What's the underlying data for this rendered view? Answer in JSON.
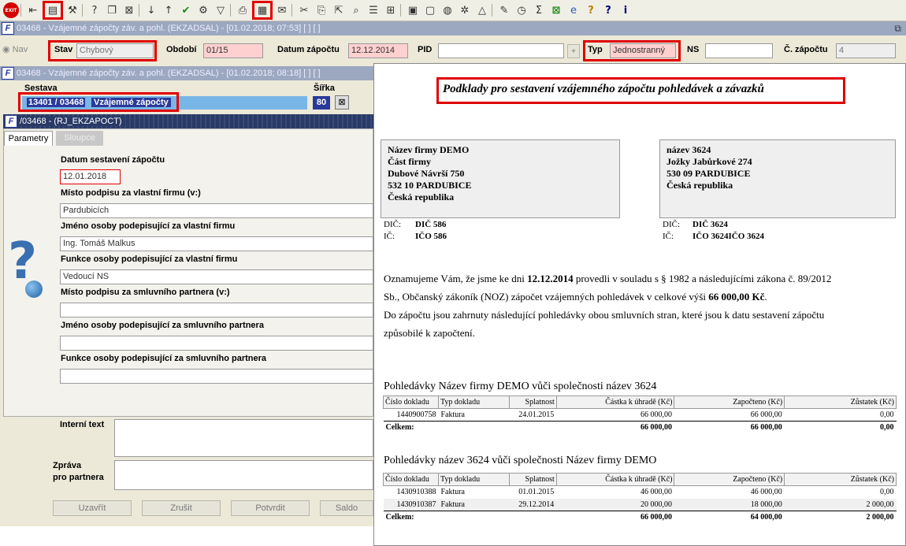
{
  "toolbar": {
    "icons": [
      "exit-icon",
      "back-icon",
      "print-preview-icon",
      "tools-icon",
      "help-find-icon",
      "copy-icon",
      "delete-icon",
      "sort-asc-icon",
      "sort-desc-icon",
      "check-icon",
      "wrench-icon",
      "filter-icon",
      "print-icon",
      "report-icon",
      "mail-icon",
      "cut-icon",
      "paste-icon",
      "attach-icon",
      "zoom-icon",
      "list-icon",
      "tree-icon",
      "save-icon",
      "doc-icon",
      "globe-icon",
      "gear-icon",
      "chart-icon",
      "edit-icon",
      "clock-icon",
      "sum-icon",
      "excel-icon",
      "browser-icon",
      "help-icon",
      "question-icon",
      "info-icon"
    ],
    "exit_label": "EXIT"
  },
  "window1": {
    "title": "03468 - Vzájemné zápočty záv. a pohl. (EKZADSAL) - [01.02.2018; 07:53]  [ ]  [ ]"
  },
  "filter": {
    "nav_label": "Nav",
    "stav_label": "Stav",
    "stav_value": "Chybový",
    "obdobi_label": "Období",
    "obdobi_value": "01/15",
    "datum_label": "Datum zápočtu",
    "datum_value": "12.12.2014",
    "pid_label": "PID",
    "pid_value": "",
    "plus": "+",
    "typ_label": "Typ",
    "typ_value": "Jednostranný",
    "ns_label": "NS",
    "ns_value": "",
    "cislo_label": "Č. zápočtu",
    "cislo_value": "4"
  },
  "window2": {
    "title": "03468 - Vzájemné zápočty záv. a pohl. (EKZADSAL) - [01.02.2018; 08:18]  [ ]  [ ]",
    "sestava_label": "Sestava",
    "sestava_code": "13401 / 03468",
    "sestava_name": "Vzájemné zápočty",
    "sirka_label": "Šířka",
    "sirka_value": "80"
  },
  "window3": {
    "title": "/03468 - (RJ_EKZAPOCT)",
    "tab_params": "Parametry",
    "tab_columns": "Sloupce",
    "fields": [
      {
        "label": "Datum sestavení zápočtu",
        "value": "12.01.2018"
      },
      {
        "label": "Místo podpisu za vlastní firmu (v:)",
        "value": "Pardubicích"
      },
      {
        "label": "Jméno osoby podepisující za vlastní firmu",
        "value": "Ing. Tomáš Malkus"
      },
      {
        "label": "Funkce osoby podepisující za vlastní firmu",
        "value": "Vedoucí NS"
      },
      {
        "label": "Místo podpisu za smluvního partnera (v:)",
        "value": ""
      },
      {
        "label": "Jméno osoby podepisující za smluvního partnera",
        "value": ""
      },
      {
        "label": "Funkce osoby podepisující za smluvního partnera",
        "value": ""
      }
    ]
  },
  "bottom": {
    "interni_label": "Interní text",
    "zprava_label1": "Zpráva",
    "zprava_label2": "pro partnera",
    "buttons": [
      "Uzavřít",
      "Zrušit",
      "Potvrdit",
      "Saldo"
    ]
  },
  "doc": {
    "title": "Podklady pro sestavení vzájemného zápočtu pohledávek a závazků",
    "left_address": [
      "Název firmy DEMO",
      "Část firmy",
      "Dubové Návrší 750",
      "532 10 PARDUBICE",
      "Česká republika"
    ],
    "right_address": [
      "název 3624",
      "Jožky Jabůrkové 274",
      "530 09 PARDUBICE",
      "Česká republika"
    ],
    "left_dic_label": "DIČ:",
    "left_dic": "DIČ 586",
    "left_ic_label": "IČ:",
    "left_ic": "IČO 586",
    "right_dic_label": "DIČ:",
    "right_dic": "DIČ 3624",
    "right_ic_label": "IČ:",
    "right_ic": "IČO 3624IČO 3624",
    "para1a": "Oznamujeme Vám, že jsme ke dni ",
    "para1date": "12.12.2014",
    "para1b": " provedli v souladu s § 1982 a následujícími zákona č. 89/2012",
    "para2a": "Sb., Občanský zákoník (NOZ) zápočet vzájemných pohledávek v celkové výši ",
    "para2amount": "66 000,00 Kč",
    "para2b": ".",
    "para3": "Do zápočtu jsou zahrnuty následující pohledávky obou smluvních stran, které jsou k datu sestavení zápočtu",
    "para4": "způsobilé k započtení.",
    "headers": [
      "Číslo dokladu",
      "Typ dokladu",
      "Splatnost",
      "Částka k úhradě (Kč)",
      "Započteno (Kč)",
      "Zůstatek (Kč)"
    ],
    "section1_title": "Pohledávky Název firmy DEMO vůči společnosti název 3624",
    "section1_rows": [
      [
        "1440900758",
        "Faktura",
        "24.01.2015",
        "66 000,00",
        "66 000,00",
        "0,00"
      ]
    ],
    "section1_total": [
      "Celkem:",
      "66 000,00",
      "66 000,00",
      "0,00"
    ],
    "section2_title": "Pohledávky název 3624 vůči společnosti Název firmy DEMO",
    "section2_rows": [
      [
        "1430910388",
        "Faktura",
        "01.01.2015",
        "46 000,00",
        "46 000,00",
        "0,00"
      ],
      [
        "1430910387",
        "Faktura",
        "29.12.2014",
        "20 000,00",
        "18 000,00",
        "2 000,00"
      ]
    ],
    "section2_total": [
      "Celkem:",
      "66 000,00",
      "64 000,00",
      "2 000,00"
    ]
  }
}
